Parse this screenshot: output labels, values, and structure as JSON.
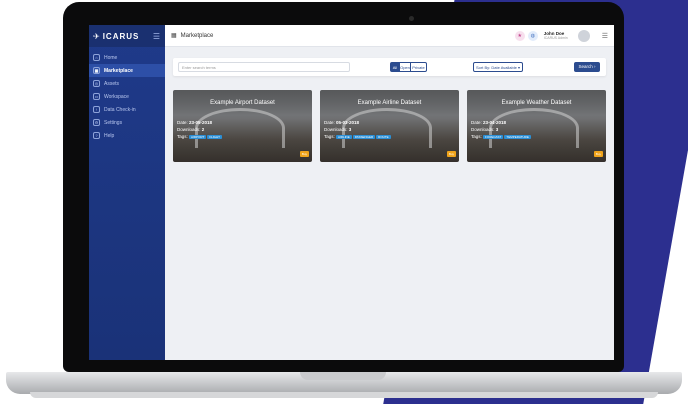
{
  "app": {
    "brand": "ICARUS",
    "page_title": "Marketplace"
  },
  "sidebar": {
    "items": [
      {
        "label": "Home",
        "icon": "home-icon"
      },
      {
        "label": "Marketplace",
        "icon": "grid-icon",
        "active": true
      },
      {
        "label": "Assets",
        "icon": "database-icon"
      },
      {
        "label": "Workspace",
        "icon": "folder-icon"
      },
      {
        "label": "Data Check-in",
        "icon": "upload-icon"
      },
      {
        "label": "Settings",
        "icon": "gear-icon"
      },
      {
        "label": "Help",
        "icon": "help-icon"
      }
    ]
  },
  "topbar": {
    "user_name": "John Doe",
    "user_role": "ICARUS Admin"
  },
  "filters": {
    "search_placeholder": "Enter search terms",
    "segments": [
      "All",
      "Open",
      "Private"
    ],
    "sort_label": "Sort By: Date Available ▾",
    "search_button": "Search"
  },
  "cards": [
    {
      "title": "Example Airport Dataset",
      "date_label": "Date:",
      "date": "23-05-2018",
      "downloads_label": "Downloads:",
      "downloads": "2",
      "tags_label": "Tags:",
      "tags": [
        "AIRPORT",
        "FLIGHT"
      ],
      "badge": "Buy"
    },
    {
      "title": "Example Airline Dataset",
      "date_label": "Date:",
      "date": "05-03-2018",
      "downloads_label": "Downloads:",
      "downloads": "3",
      "tags_label": "Tags:",
      "tags": [
        "AIRLINE",
        "PASSENGER",
        "ROUTE"
      ],
      "badge": "Buy"
    },
    {
      "title": "Example Weather Dataset",
      "date_label": "Date:",
      "date": "23-04-2018",
      "downloads_label": "Downloads:",
      "downloads": "3",
      "tags_label": "Tags:",
      "tags": [
        "FORECAST",
        "TEMPERATURE"
      ],
      "badge": "Buy"
    }
  ],
  "colors": {
    "sidebar": "#1f3a8a",
    "accent": "#2c4c8f",
    "badge": "#f0a41b",
    "tag": "#2b8fd6"
  }
}
